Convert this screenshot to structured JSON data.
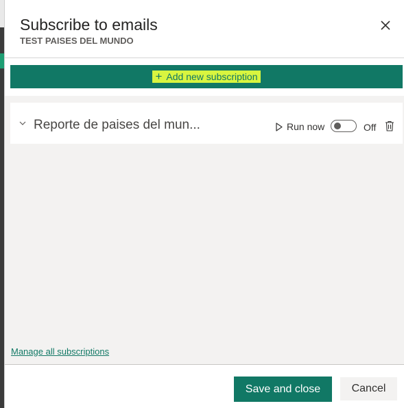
{
  "dialog": {
    "title": "Subscribe to emails",
    "subtitle": "TEST PAISES DEL MUNDO",
    "close_icon": "close-icon"
  },
  "add_button": {
    "icon": "plus-icon",
    "label": "Add new subscription"
  },
  "subscriptions": [
    {
      "name": "Reporte de paises del mun...",
      "run_now_label": "Run now",
      "toggle_state": "Off",
      "icons": [
        "chevron-down-icon",
        "play-icon",
        "trash-icon"
      ]
    }
  ],
  "manage_link": "Manage all subscriptions",
  "footer": {
    "save_label": "Save and close",
    "cancel_label": "Cancel"
  },
  "colors": {
    "accent": "#117865",
    "highlight": "#d8f53f",
    "content_bg": "#f3f2f1"
  }
}
